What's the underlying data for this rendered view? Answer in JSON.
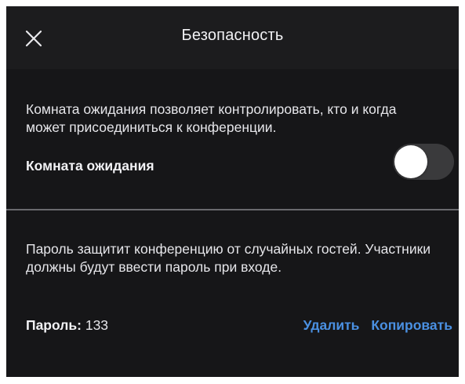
{
  "header": {
    "title": "Безопасность",
    "close_icon": "close-icon"
  },
  "waiting_room": {
    "description": "Комната ожидания позволяет контролировать, кто и когда может присоединиться к конференции.",
    "label": "Комната ожидания",
    "enabled": false
  },
  "password": {
    "description": "Пароль защитит конференцию от случайных гостей. Участники должны будут ввести пароль при входе.",
    "label": "Пароль:",
    "value": "133",
    "delete_label": "Удалить",
    "copy_label": "Копировать"
  },
  "colors": {
    "panel_background": "#1c1c1e",
    "accent": "#4a90e2",
    "text": "#ebebef"
  }
}
